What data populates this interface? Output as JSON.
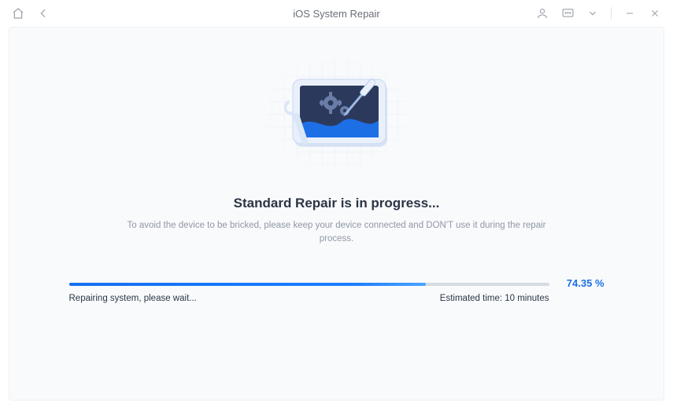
{
  "titlebar": {
    "title": "iOS System Repair"
  },
  "main": {
    "heading": "Standard Repair is in progress...",
    "subtext": "To avoid the device to be bricked, please keep your device connected and DON'T use it during the repair process."
  },
  "progress": {
    "percent_value": 74.35,
    "percent_label": "74.35 %",
    "fill_width": "74.35%",
    "status_text": "Repairing system, please wait...",
    "estimate_text": "Estimated time: 10 minutes"
  },
  "colors": {
    "accent": "#1d6fe6",
    "track": "#d6dbe4",
    "panel_bg": "#f8fafc",
    "text_heading": "#2b3544",
    "text_muted": "#9198a3"
  }
}
